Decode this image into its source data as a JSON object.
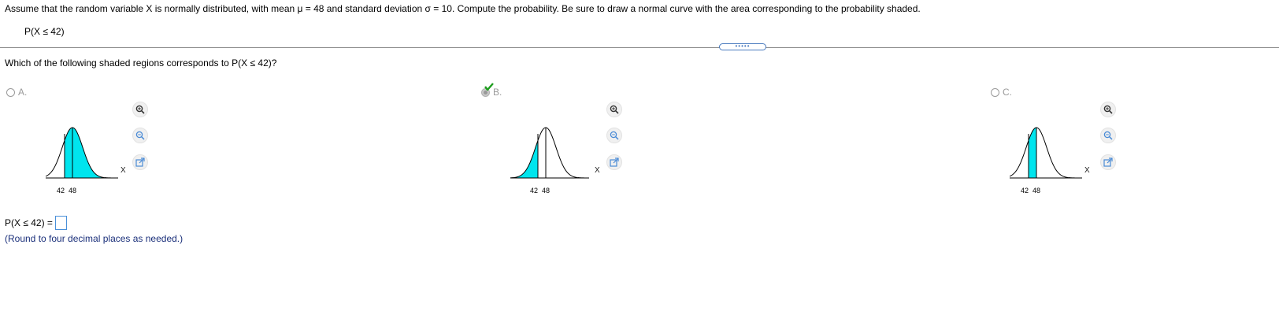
{
  "problem": {
    "statement": "Assume that the random variable X is normally distributed, with mean μ = 48 and standard deviation σ = 10. Compute the probability. Be sure to draw a normal curve with the area corresponding to the probability shaded.",
    "expression": "P(X ≤ 42)"
  },
  "expand_handle": "•••••",
  "question": "Which of the following shaded regions corresponds to P(X ≤ 42)?",
  "choices": [
    {
      "label": "A.",
      "selected": false,
      "shading": "between 42 and 48 and right tail"
    },
    {
      "label": "B.",
      "selected": true,
      "shading": "left of 42"
    },
    {
      "label": "C.",
      "selected": false,
      "shading": "between 42 and 48"
    }
  ],
  "curve": {
    "tick_label_1": "42",
    "tick_label_2": "48",
    "axis_label": "X"
  },
  "answer": {
    "prompt": "P(X ≤ 42) =",
    "value": "",
    "note": "(Round to four decimal places as needed.)"
  },
  "colors": {
    "shade": "#00e5ee",
    "accent": "#4a90d9",
    "check": "#1e9e1e",
    "note_text": "#1a2f7a"
  },
  "icons": [
    "zoom-in-icon",
    "zoom-out-icon",
    "pop-out-icon",
    "checkmark-icon"
  ]
}
